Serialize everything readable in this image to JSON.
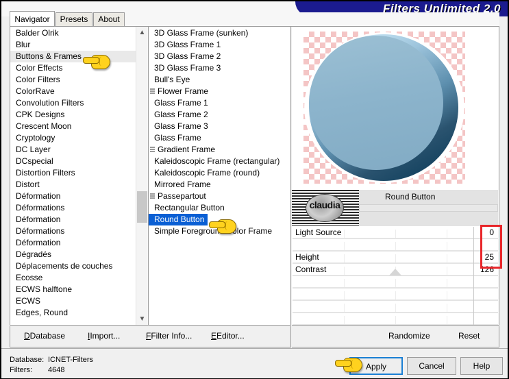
{
  "window": {
    "banner_title": "Filters Unlimited 2.0"
  },
  "tabs": [
    {
      "label": "Navigator",
      "active": true
    },
    {
      "label": "Presets",
      "active": false
    },
    {
      "label": "About",
      "active": false
    }
  ],
  "categories": {
    "selected": "Buttons & Frames",
    "items": [
      "Balder Olrik",
      "Blur",
      "Buttons & Frames",
      "Color Effects",
      "Color Filters",
      "ColorRave",
      "Convolution Filters",
      "CPK Designs",
      "Crescent Moon",
      "Cryptology",
      "DC Layer",
      "DCspecial",
      "Distortion Filters",
      "Distort",
      "Déformation",
      "Déformations",
      "Déformation",
      "Déformations",
      "Déformation",
      "Dégradés",
      "Déplacements de couches",
      "Ecosse",
      "ECWS halftone",
      "ECWS",
      "Edges, Round"
    ]
  },
  "filters": {
    "selected": "Round Button",
    "items": [
      {
        "label": "3D Glass Frame (sunken)",
        "grip": false
      },
      {
        "label": "3D Glass Frame 1",
        "grip": false
      },
      {
        "label": "3D Glass Frame 2",
        "grip": false
      },
      {
        "label": "3D Glass Frame 3",
        "grip": false
      },
      {
        "label": "Bull's Eye",
        "grip": false
      },
      {
        "label": "Flower Frame",
        "grip": true
      },
      {
        "label": "Glass Frame 1",
        "grip": false
      },
      {
        "label": "Glass Frame 2",
        "grip": false
      },
      {
        "label": "Glass Frame 3",
        "grip": false
      },
      {
        "label": "Glass Frame",
        "grip": false
      },
      {
        "label": "Gradient Frame",
        "grip": true
      },
      {
        "label": "Kaleidoscopic Frame (rectangular)",
        "grip": false
      },
      {
        "label": "Kaleidoscopic Frame (round)",
        "grip": false
      },
      {
        "label": "Mirrored Frame",
        "grip": false
      },
      {
        "label": "Passepartout",
        "grip": true
      },
      {
        "label": "Rectangular Button",
        "grip": false
      },
      {
        "label": "Round Button",
        "grip": false
      },
      {
        "label": "Simple Foreground Color Frame",
        "grip": false
      }
    ]
  },
  "preview": {
    "filter_name": "Round Button",
    "watermark": "claudia"
  },
  "parameters": [
    {
      "label": "Light Source",
      "value": "0",
      "handle_pct": null
    },
    {
      "label": "",
      "value": "",
      "handle_pct": null
    },
    {
      "label": "Height",
      "value": "25",
      "handle_pct": null
    },
    {
      "label": "Contrast",
      "value": "126",
      "handle_pct": 50
    },
    {
      "label": "",
      "value": "",
      "handle_pct": null
    },
    {
      "label": "",
      "value": "",
      "handle_pct": null
    },
    {
      "label": "",
      "value": "",
      "handle_pct": null
    },
    {
      "label": "",
      "value": "",
      "handle_pct": null
    }
  ],
  "links": {
    "database": "Database",
    "import": "Import...",
    "filter_info": "Filter Info...",
    "editor": "Editor...",
    "randomize": "Randomize",
    "reset": "Reset"
  },
  "status": {
    "database_key": "Database:",
    "database_value": "ICNET-Filters",
    "filters_key": "Filters:",
    "filters_value": "4648"
  },
  "buttons": {
    "apply": "Apply",
    "cancel": "Cancel",
    "help": "Help"
  },
  "colors": {
    "banner": "#1b1b8f",
    "selection": "#0a5fd4",
    "annotation": "#e8262a",
    "focus": "#1a7fd4",
    "cursor": "#ffd21e"
  }
}
